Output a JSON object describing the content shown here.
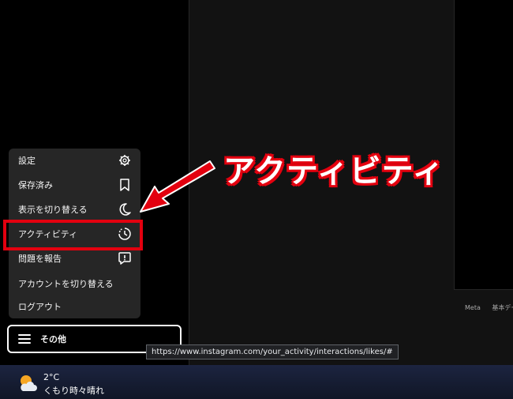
{
  "menu": {
    "items": [
      {
        "label": "設定",
        "icon": "gear-icon"
      },
      {
        "label": "保存済み",
        "icon": "bookmark-icon"
      },
      {
        "label": "表示を切り替える",
        "icon": "moon-icon"
      },
      {
        "label": "アクティビティ",
        "icon": "activity-clock-icon"
      },
      {
        "label": "問題を報告",
        "icon": "report-icon"
      },
      {
        "label": "アカウントを切り替える",
        "icon": ""
      },
      {
        "label": "ログアウト",
        "icon": ""
      }
    ]
  },
  "more_button": {
    "label": "その他",
    "icon": "hamburger-icon"
  },
  "footer": {
    "links": [
      "Meta",
      "基本デー"
    ]
  },
  "status_url": "https://www.instagram.com/your_activity/interactions/likes/#",
  "taskbar": {
    "temperature": "2°C",
    "condition": "くもり時々晴れ",
    "icon": "weather-partly-cloudy-icon"
  },
  "annotation": {
    "callout": "アクティビティ",
    "color": "#e3000f"
  }
}
